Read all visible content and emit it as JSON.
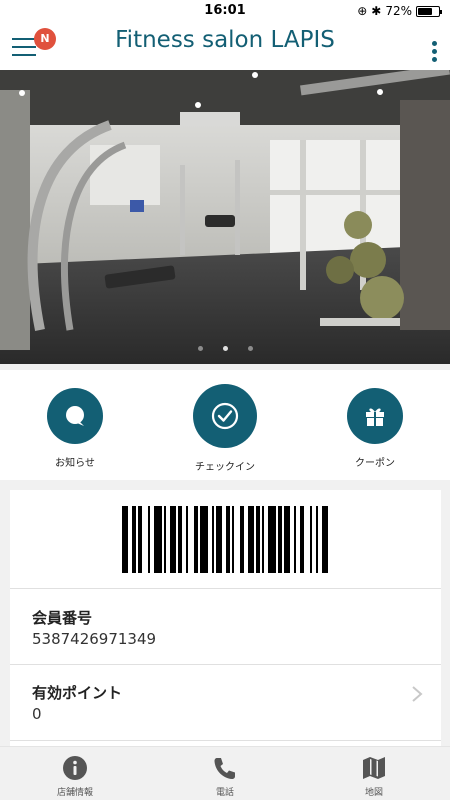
{
  "status_bar": {
    "time": "16:01",
    "battery": "72%",
    "battery_level": 0.72
  },
  "header": {
    "title": "Fitness salon LAPIS",
    "notification_badge": "N"
  },
  "hero": {
    "slide_count": 3,
    "active_slide": 1,
    "image_label": "gym interior photo"
  },
  "quick_actions": [
    {
      "label": "お知らせ",
      "icon": "chat-bubble-icon"
    },
    {
      "label": "チェックイン",
      "icon": "check-circle-icon"
    },
    {
      "label": "クーポン",
      "icon": "gift-icon"
    }
  ],
  "member": {
    "number_label": "会員番号",
    "number_value": "5387426971349",
    "points_label": "有効ポイント",
    "points_value": "0"
  },
  "tabs": [
    {
      "label": "店舗情報",
      "icon": "info-icon"
    },
    {
      "label": "電話",
      "icon": "phone-icon"
    },
    {
      "label": "地図",
      "icon": "map-icon"
    }
  ],
  "colors": {
    "brand": "#135f74",
    "badge": "#e0513d",
    "background": "#f1f1f1"
  }
}
